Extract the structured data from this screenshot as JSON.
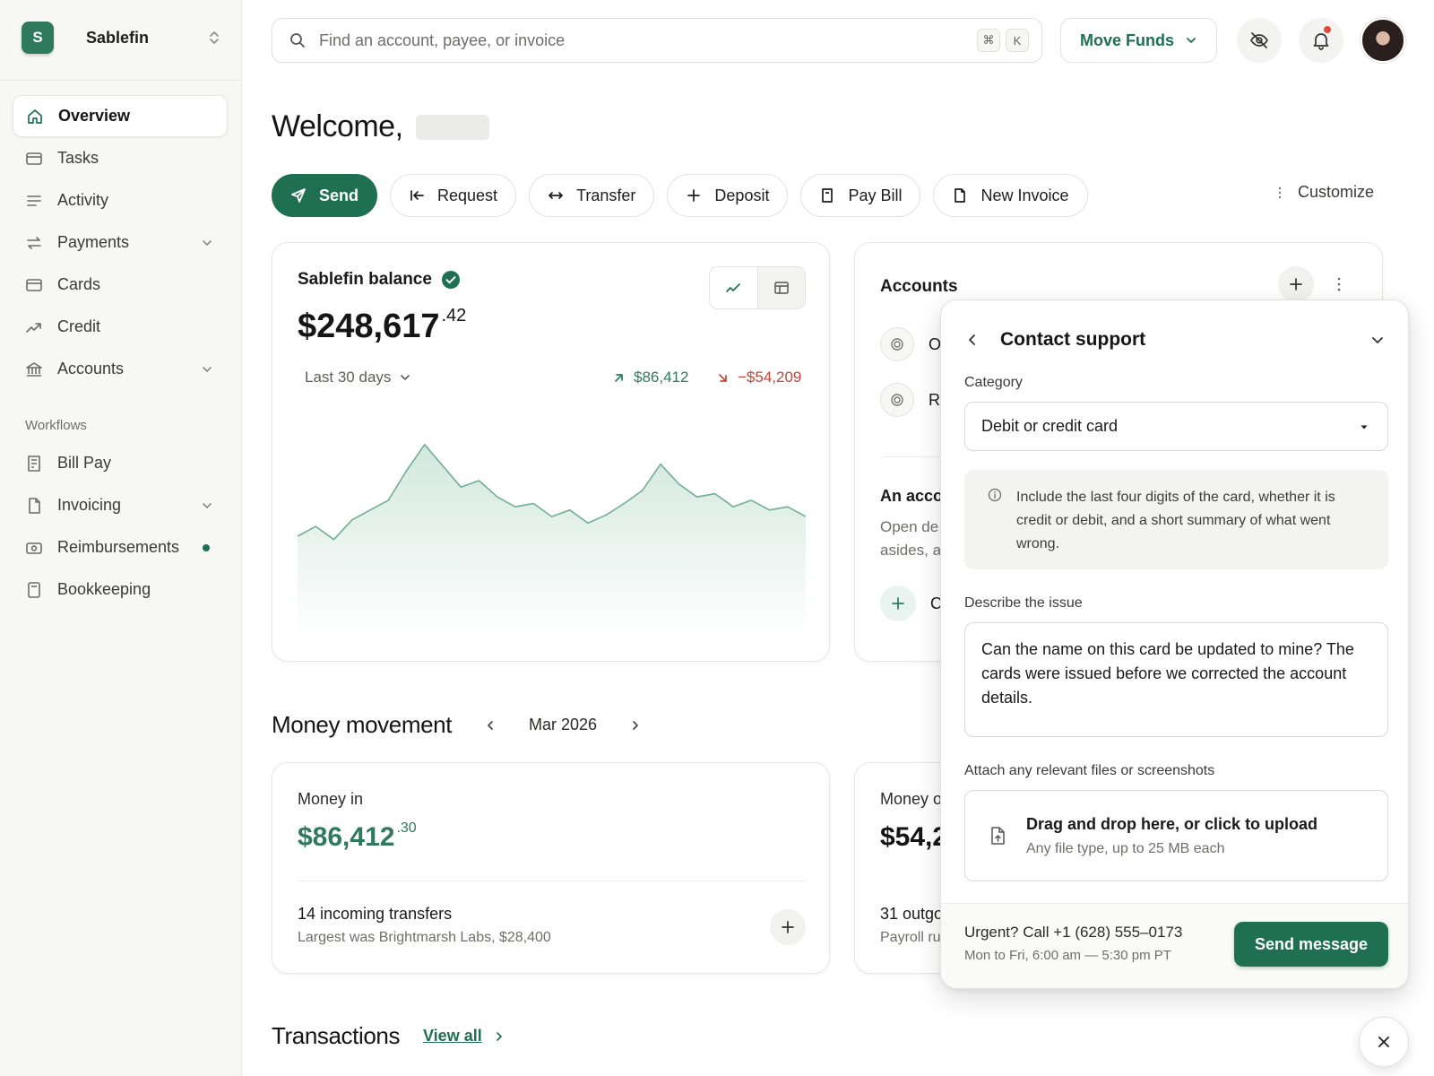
{
  "org": {
    "initial": "S",
    "name": "Sablefin"
  },
  "nav": {
    "items": [
      {
        "label": "Overview"
      },
      {
        "label": "Tasks"
      },
      {
        "label": "Activity"
      },
      {
        "label": "Payments"
      },
      {
        "label": "Cards"
      },
      {
        "label": "Credit"
      },
      {
        "label": "Accounts"
      }
    ],
    "workflows_heading": "Workflows",
    "workflow_items": [
      {
        "label": "Bill Pay"
      },
      {
        "label": "Invoicing"
      },
      {
        "label": "Reimbursements"
      },
      {
        "label": "Bookkeeping"
      }
    ]
  },
  "search": {
    "placeholder": "Find an account, payee, or invoice",
    "shortcut_mod": "⌘",
    "shortcut_key": "K"
  },
  "header": {
    "move_funds": "Move Funds"
  },
  "welcome": {
    "text": "Welcome,"
  },
  "actions": {
    "send": "Send",
    "request": "Request",
    "transfer": "Transfer",
    "deposit": "Deposit",
    "pay_bill": "Pay Bill",
    "new_invoice": "New Invoice",
    "customize": "Customize"
  },
  "balance": {
    "title": "Sablefin balance",
    "amount_main": "$248,617",
    "amount_cents": ".42",
    "period": "Last 30 days",
    "inflow": "$86,412",
    "outflow": "−$54,209"
  },
  "chart_data": {
    "type": "area",
    "title": "",
    "xlabel": "",
    "ylabel": "",
    "grid": false,
    "values": [
      52,
      58,
      50,
      62,
      68,
      74,
      92,
      108,
      95,
      82,
      86,
      76,
      70,
      72,
      64,
      68,
      60,
      65,
      72,
      80,
      96,
      84,
      76,
      78,
      70,
      74,
      68,
      70,
      64
    ]
  },
  "accounts": {
    "title": "Accounts",
    "rows": [
      {
        "label": "O"
      },
      {
        "label": "R"
      }
    ],
    "promo_title": "An acco",
    "promo_text_1": "Open de",
    "promo_text_2": "asides, a",
    "add_label": "C"
  },
  "money_movement": {
    "title": "Money movement",
    "month": "Mar 2026",
    "in": {
      "label": "Money in",
      "amount_main": "$86,412",
      "amount_cents": ".30",
      "row1": "14 incoming transfers",
      "row2": "Largest was Brightmarsh Labs, $28,400"
    },
    "out": {
      "label": "Money o",
      "amount_main": "$54,2",
      "row1": "31 outgo",
      "row2": "Payroll ru"
    }
  },
  "transactions": {
    "title": "Transactions",
    "view_all": "View all"
  },
  "support": {
    "title": "Contact support",
    "category_label": "Category",
    "category_value": "Debit or credit card",
    "info_text": "Include the last four digits of the card, whether it is credit or debit, and a short summary of what went wrong.",
    "describe_label": "Describe the issue",
    "describe_value": "Can the name on this card be updated to mine? The cards were issued before we corrected the account details.",
    "attach_label": "Attach any relevant files or screenshots",
    "upload_title": "Drag and drop here, or click to upload",
    "upload_hint": "Any file type, up to 25 MB each",
    "urgent": "Urgent? Call +1 (628) 555–0173",
    "hours": "Mon to Fri, 6:00 am — 5:30 pm PT",
    "send": "Send message"
  },
  "colors": {
    "accent": "#1f6f53",
    "inflow": "#2f7a5d",
    "outflow": "#c0463a",
    "chart_line": "#6fae95",
    "chart_fill": "#d3e9df"
  }
}
